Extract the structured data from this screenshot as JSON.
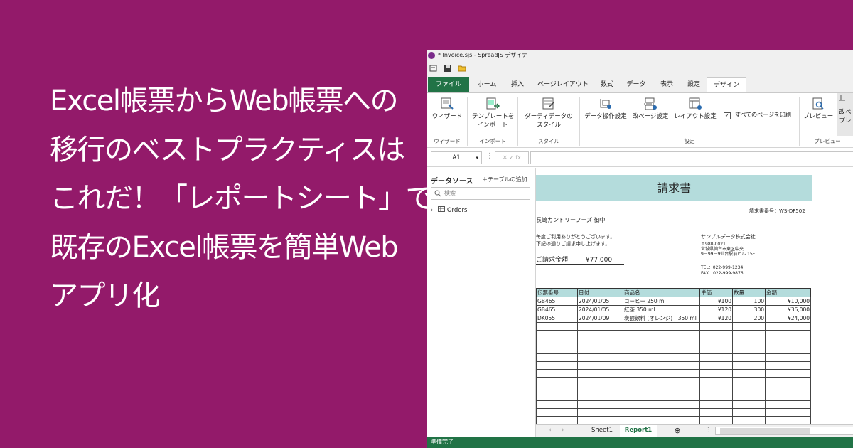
{
  "headline": [
    "Excel帳票からWeb帳票への",
    "移行のベストプラクティスは",
    "これだ！「レポートシート」で",
    "既存のExcel帳票を簡単Web",
    "アプリ化"
  ],
  "window": {
    "title": "* Invoice.sjs - SpreadJS デザイナ"
  },
  "menu": {
    "tabs": [
      "ファイル",
      "ホーム",
      "挿入",
      "ページレイアウト",
      "数式",
      "データ",
      "表示",
      "設定",
      "デザイン"
    ]
  },
  "ribbon": {
    "wizard": "ウィザード",
    "template_import_1": "テンプレートを",
    "template_import_2": "インポート",
    "dirty_style_1": "ダーティデータの",
    "dirty_style_2": "スタイル",
    "data_op": "データ操作設定",
    "page_break": "改ページ設定",
    "layout": "レイアウト設定",
    "all_pages_print": "すべてのページを印刷",
    "preview": "プレビュー",
    "partial_label": "改ペ\nプレ",
    "groups": {
      "wizard": "ウィザード",
      "import": "インポート",
      "style": "スタイル",
      "settings": "設定",
      "preview": "プレビュー"
    }
  },
  "formula_bar": {
    "cell_ref": "A1",
    "fx": "✕ ✓ fx"
  },
  "datasource": {
    "title": "データソース",
    "add_table": "＋テーブルの追加",
    "search_placeholder": "検索",
    "tree_item": "Orders"
  },
  "sheet": {
    "title": "請求書",
    "invoice_no": "請求書番号：WS-DF502",
    "customer": "長崎カントリーフーズ 御中",
    "greeting_1": "毎度ご利用ありがとうございます。",
    "greeting_2": "下記の通りご請求申し上げます。",
    "company": "サンプルデータ株式会社",
    "postal": "〒980-0021",
    "address_1": "宮城県仙台市東区中央",
    "address_2": "9－99－9仙台駅前ビル 15F",
    "amount_label": "ご請求金額",
    "amount_value": "¥77,000",
    "tel": "TEL：022-999-1234",
    "fax": "FAX：022-999-9876",
    "table_headers": [
      "伝票番号",
      "日付",
      "商品名",
      "単価",
      "数量",
      "金額"
    ],
    "rows": [
      [
        "GB465",
        "2024/01/05",
        "コーヒー 250 ml",
        "¥100",
        "100",
        "¥10,000"
      ],
      [
        "GB465",
        "2024/01/05",
        "紅茶 350 ml",
        "¥120",
        "300",
        "¥36,000"
      ],
      [
        "DK055",
        "2024/01/09",
        "炭酸飲料 (オレンジ)　350 ml",
        "¥120",
        "200",
        "¥24,000"
      ]
    ]
  },
  "sheet_tabs": [
    "Sheet1",
    "Report1"
  ],
  "status": "準備完了",
  "colors": {
    "background": "#931a6a",
    "accent": "#217346",
    "header_fill": "#b4dcdc"
  }
}
